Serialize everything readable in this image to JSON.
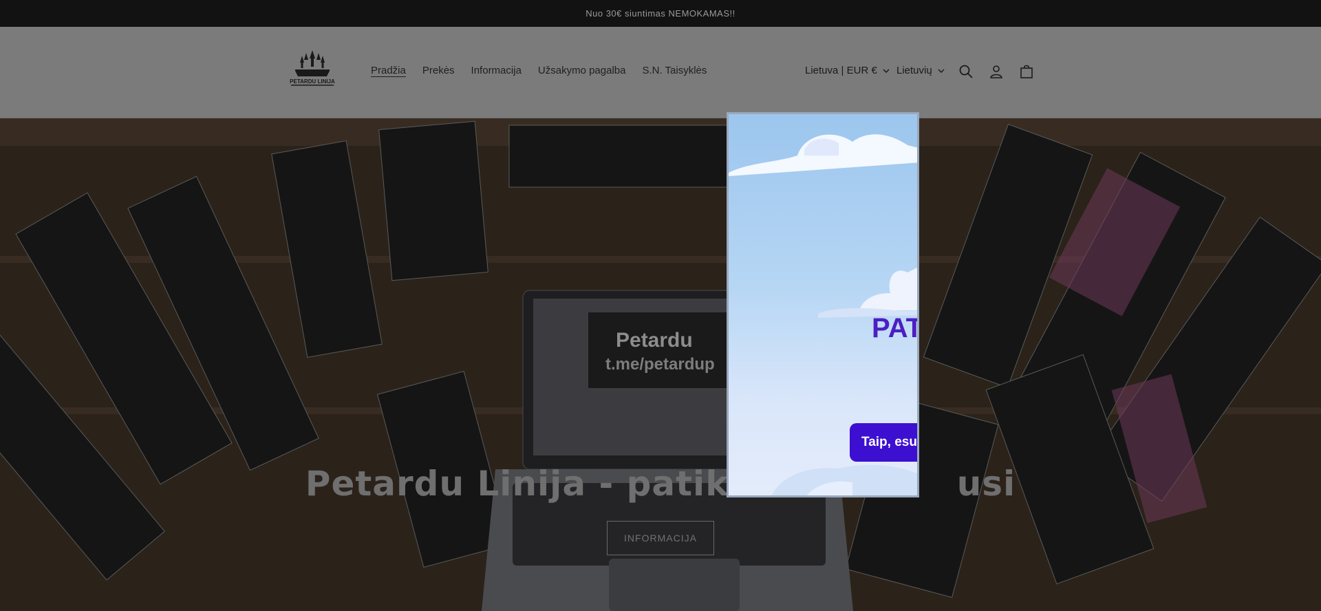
{
  "announcement": {
    "text": "Nuo 30€ siuntimas NEMOKAMAS!!"
  },
  "header": {
    "logo_text": "PETARDU LINIJA",
    "nav": [
      {
        "label": "Pradžia",
        "active": true
      },
      {
        "label": "Prekės",
        "active": false
      },
      {
        "label": "Informacija",
        "active": false
      },
      {
        "label": "Užsakymo pagalba",
        "active": false
      },
      {
        "label": "S.N. Taisyklės",
        "active": false
      }
    ],
    "country_selector": "Lietuva | EUR €",
    "language_selector": "Lietuvių",
    "icons": [
      "search-icon",
      "account-icon",
      "cart-icon"
    ]
  },
  "hero": {
    "title": "Petardu Linija - patikim",
    "title_tail": "usi",
    "button_label": "INFORMACIJA"
  },
  "modal": {
    "title": "PAT",
    "button_label": "Taip, esu"
  },
  "colors": {
    "announcement_bg": "#121212",
    "header_bg": "#7b7b7b",
    "modal_title": "#4b1fc3",
    "modal_button": "#3d0fd0"
  }
}
